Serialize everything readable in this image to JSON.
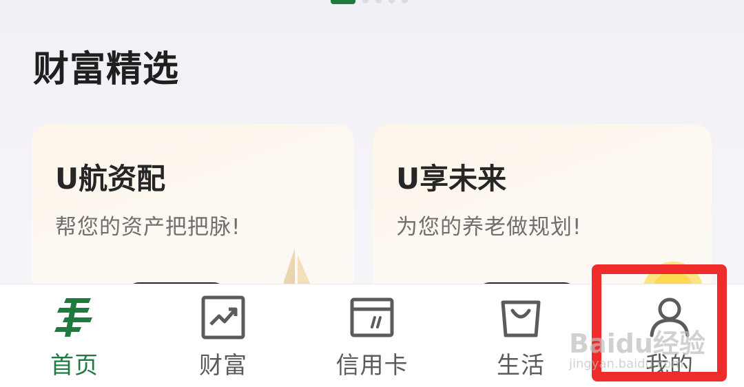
{
  "section": {
    "title": "财富精选"
  },
  "pager": {
    "total_pages": 5,
    "current_page": 1
  },
  "cards": [
    {
      "title": "U航资配",
      "subtitle": "帮您的资产把把脉!"
    },
    {
      "title": "U享未来",
      "subtitle": "为您的养老做规划!"
    }
  ],
  "tabbar": {
    "items": [
      {
        "label": "首页",
        "icon": "postal-logo-icon",
        "active": true
      },
      {
        "label": "财富",
        "icon": "chart-icon",
        "active": false
      },
      {
        "label": "信用卡",
        "icon": "card-icon",
        "active": false
      },
      {
        "label": "生活",
        "icon": "bag-icon",
        "active": false
      },
      {
        "label": "我的",
        "icon": "user-icon",
        "active": false
      }
    ]
  },
  "colors": {
    "brand_green": "#1f7a3f",
    "highlight_red": "#ef2c2c",
    "card_bg": "#fdf6ec"
  },
  "watermark": {
    "main": "Baidu经验",
    "sub": "jingyan.baidu.com"
  }
}
